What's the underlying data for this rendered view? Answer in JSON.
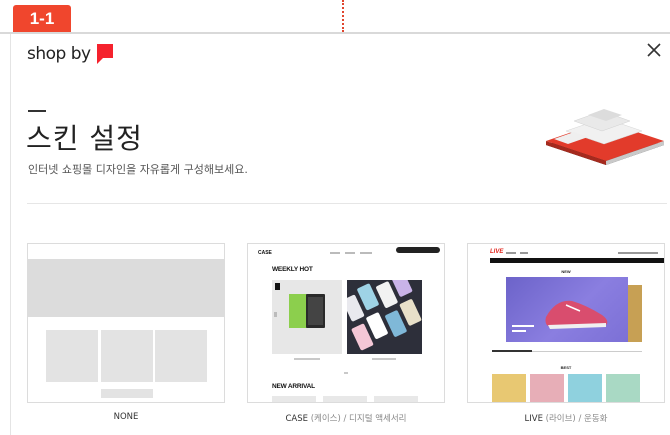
{
  "step_badge": "1-1",
  "brand": {
    "logo_text": "shop by",
    "accent": "#f5222d"
  },
  "modal": {
    "title": "스킨 설정",
    "subtitle": "인터넷 쇼핑몰 디자인을 자유롭게 구성해보세요.",
    "close_icon": "close-icon"
  },
  "skins": [
    {
      "label": "NONE",
      "sub": ""
    },
    {
      "label": "CASE",
      "sub": " (케이스) / 디지털 액세서리"
    },
    {
      "label": "LIVE",
      "sub": " (라이브) / 운동화"
    }
  ],
  "case_preview": {
    "logo": "CASE",
    "section1": "WEEKLY HOT",
    "section2": "NEW ARRIVAL"
  },
  "live_preview": {
    "logo": "LIVE",
    "section1": "NEW",
    "section2": "BEST"
  },
  "colors": {
    "badge": "#f0462d",
    "guide": "#e0452e",
    "live_red": "#e2231a"
  }
}
